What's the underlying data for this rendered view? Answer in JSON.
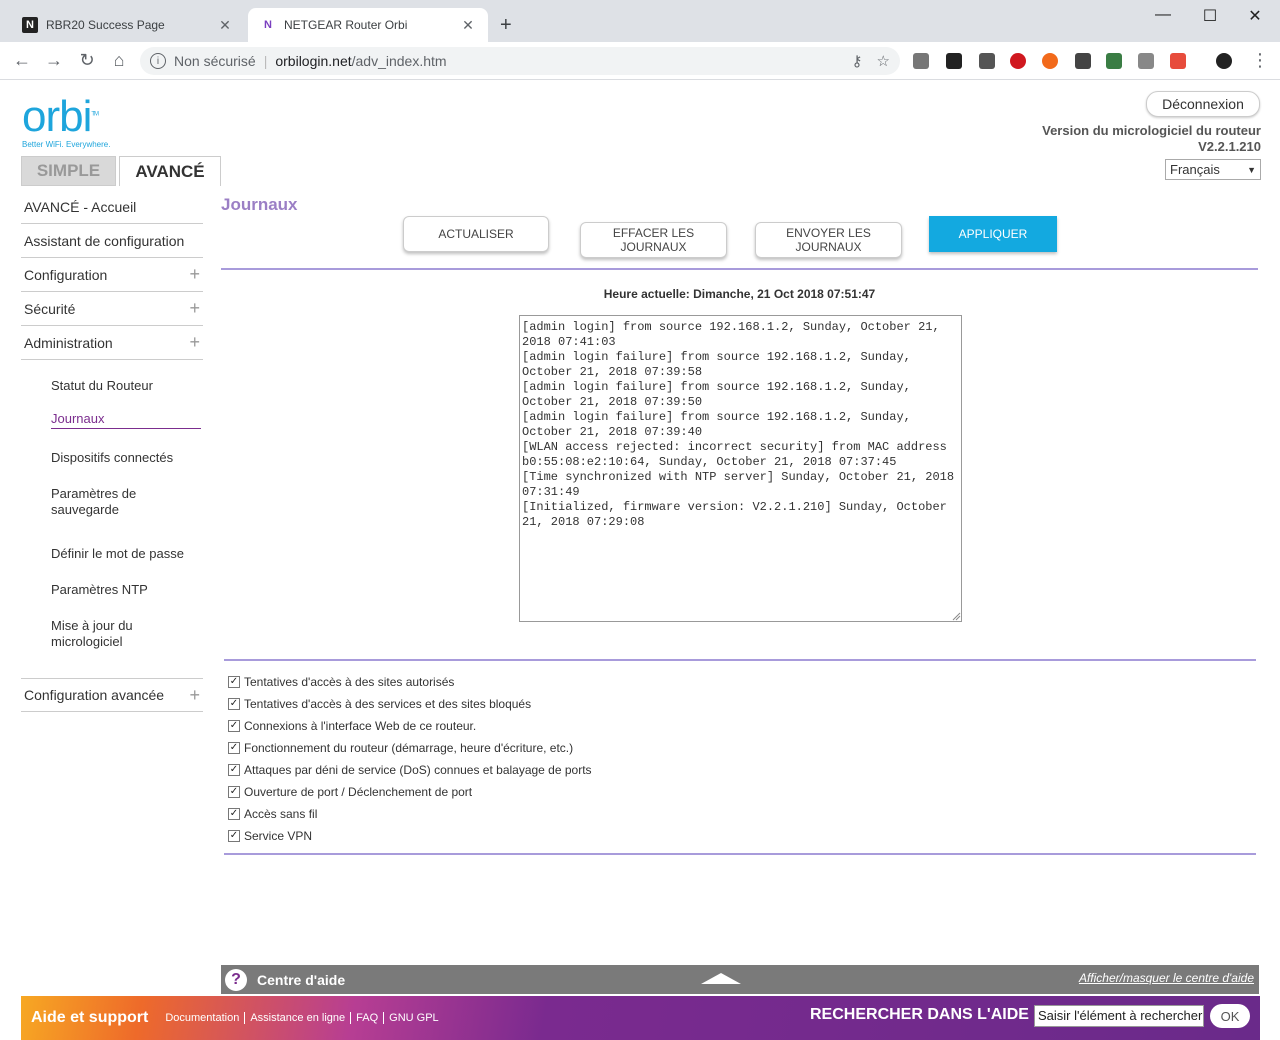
{
  "browser": {
    "tabs": [
      {
        "title": "RBR20 Success Page",
        "favicon": "N"
      },
      {
        "title": "NETGEAR Router Orbi",
        "favicon": "N"
      }
    ],
    "new_tab": "+",
    "window_controls": [
      "—",
      "☐",
      "✕"
    ],
    "nav": {
      "back": "←",
      "forward": "→",
      "reload": "↻",
      "home": "⌂"
    },
    "omnibox": {
      "security_label": "Non sécurisé",
      "host": "orbilogin.net",
      "path": "/adv_index.htm"
    }
  },
  "header": {
    "logo": "orbi",
    "logo_tm": "TM",
    "tagline": "Better WiFi. Everywhere.",
    "logout_label": "Déconnexion",
    "firmware_label": "Version du micrologiciel du routeur",
    "firmware_version": "V2.2.1.210",
    "language": "Français"
  },
  "mode_tabs": {
    "simple": "SIMPLE",
    "advanced": "AVANCÉ"
  },
  "sidebar": {
    "items": [
      {
        "label": "AVANCÉ - Accueil",
        "expandable": false
      },
      {
        "label": "Assistant de configuration",
        "expandable": false
      },
      {
        "label": "Configuration",
        "expandable": true
      },
      {
        "label": "Sécurité",
        "expandable": true
      },
      {
        "label": "Administration",
        "expandable": true
      }
    ],
    "sub_items": [
      "Statut du Routeur",
      "Journaux",
      "Dispositifs connectés",
      "Paramètres de sauvegarde",
      "Définir le mot de passe",
      "Paramètres NTP",
      "Mise à jour du micrologiciel"
    ],
    "active_sub": "Journaux",
    "advanced_config": "Configuration avancée"
  },
  "main": {
    "title": "Journaux",
    "buttons": {
      "refresh": "ACTUALISER",
      "clear": "EFFACER LES JOURNAUX",
      "send": "ENVOYER LES JOURNAUX",
      "apply": "APPLIQUER"
    },
    "current_time": "Heure actuelle: Dimanche, 21 Oct 2018 07:51:47",
    "log_text": "[admin login] from source 192.168.1.2, Sunday, October 21, 2018 07:41:03\n[admin login failure] from source 192.168.1.2, Sunday, October 21, 2018 07:39:58\n[admin login failure] from source 192.168.1.2, Sunday, October 21, 2018 07:39:50\n[admin login failure] from source 192.168.1.2, Sunday, October 21, 2018 07:39:40\n[WLAN access rejected: incorrect security] from MAC address b0:55:08:e2:10:64, Sunday, October 21, 2018 07:37:45\n[Time synchronized with NTP server] Sunday, October 21, 2018 07:31:49\n[Initialized, firmware version: V2.2.1.210] Sunday, October 21, 2018 07:29:08",
    "options": [
      {
        "label": "Tentatives d'accès à des sites autorisés",
        "checked": true
      },
      {
        "label": "Tentatives d'accès à des services et des sites bloqués",
        "checked": true
      },
      {
        "label": "Connexions à l'interface Web de ce routeur.",
        "checked": true
      },
      {
        "label": "Fonctionnement du routeur (démarrage, heure d'écriture, etc.)",
        "checked": true
      },
      {
        "label": "Attaques par déni de service (DoS) connues et balayage de ports",
        "checked": true
      },
      {
        "label": " Ouverture de port / Déclenchement de port",
        "checked": true
      },
      {
        "label": "Accès sans fil",
        "checked": true
      },
      {
        "label": "Service VPN",
        "checked": true
      }
    ]
  },
  "help": {
    "title": "Centre d'aide",
    "toggle": "Afficher/masquer le centre d'aide"
  },
  "footer": {
    "title": "Aide et support",
    "links": [
      "Documentation",
      "Assistance en ligne",
      "FAQ",
      "GNU GPL"
    ],
    "search_label": "RECHERCHER DANS L'AIDE",
    "search_value": "Saisir l'élément à rechercher",
    "ok": "OK"
  },
  "colors": {
    "accent_blue": "#13a9e0",
    "active_purple": "#7b2d8e",
    "divider_lavender": "#a89bdb",
    "logo_blue": "#1ea5dc"
  }
}
